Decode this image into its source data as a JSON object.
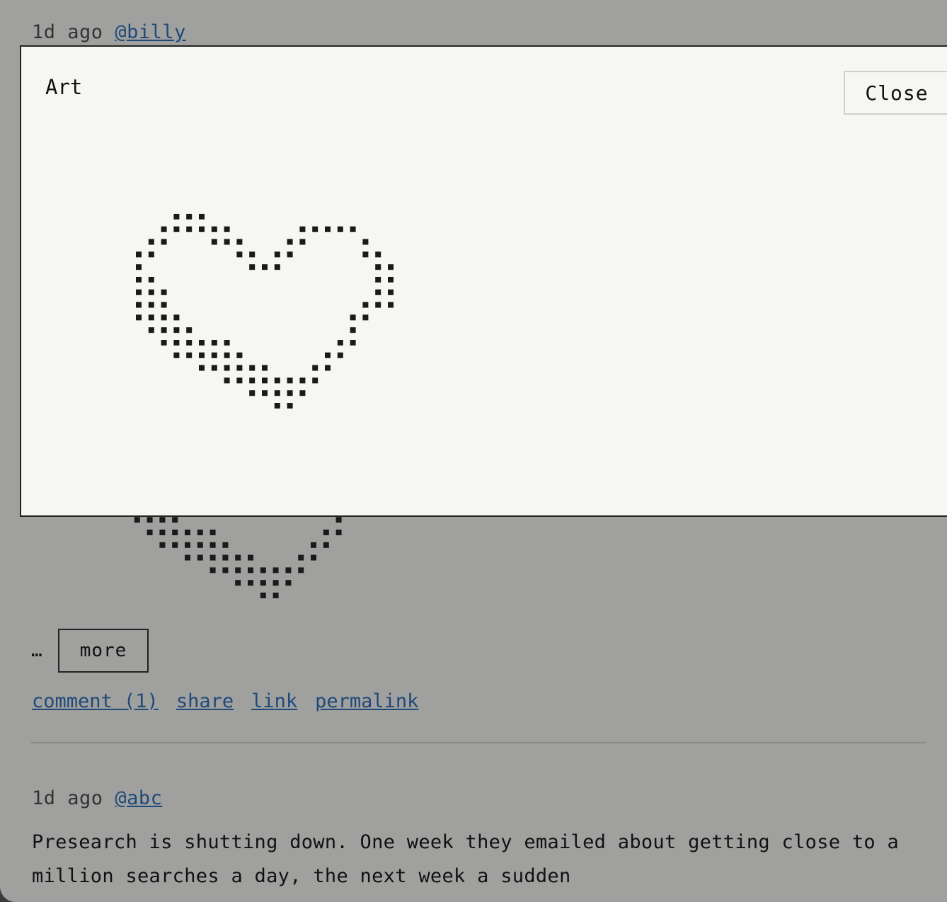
{
  "post1": {
    "time": "1d ago",
    "user": "@billy",
    "ellipsis": "…",
    "more_label": "more",
    "actions": [
      "comment (1)",
      "share",
      "link",
      "permalink"
    ]
  },
  "post2": {
    "time": "1d ago",
    "user": "@abc",
    "text": "Presearch is shutting down. One week they emailed about getting close to a million searches a day, the next week a sudden"
  },
  "modal": {
    "title": "Art",
    "close_label": "Close"
  },
  "colors": {
    "overlay_bg": "#a0a09f",
    "modal_bg": "#f6f6f2",
    "link": "#1f4a78",
    "pixel": "#1a1a1a"
  },
  "art": {
    "type": "dotted-heart",
    "description_icon": "heart-icon"
  }
}
